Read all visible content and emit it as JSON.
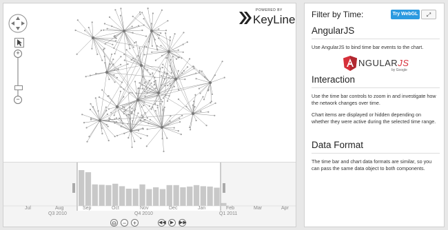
{
  "branding": {
    "powered_by": "POWERED BY",
    "product": "KeyLines"
  },
  "right_panel": {
    "filter_title": "Filter by Time:",
    "try_webgl_label": "Try WebGL",
    "expand_icon": "expand-icon",
    "sections": [
      {
        "heading": "AngularJS",
        "paragraphs": [
          "Use AngularJS to bind time bar events to the chart."
        ]
      },
      {
        "heading": "Interaction",
        "paragraphs": [
          "Use the time bar controls to zoom in and investigate how the network changes over time.",
          "Chart items are displayed or hidden depending on whether they were active during the selected time range."
        ]
      },
      {
        "heading": "Data Format",
        "paragraphs": [
          "The time bar and chart data formats are similar, so you can pass the same data object to both components."
        ]
      }
    ],
    "angular_logo": {
      "word_a": "A",
      "word_rest": "NGULAR",
      "word_js": "JS",
      "byline": "by Google",
      "colors": {
        "shield": "#d6303a",
        "text": "#333333",
        "js": "#d6303a"
      }
    }
  },
  "timebar": {
    "months": [
      "Jul",
      "Aug",
      "Sep",
      "Oct",
      "Nov",
      "Dec",
      "Jan",
      "Feb",
      "Mar",
      "Apr"
    ],
    "periods": [
      "Q3 2010",
      "Q4 2010",
      "Q1 2011"
    ],
    "bar_values": [
      100,
      94,
      60,
      59,
      58,
      62,
      55,
      48,
      48,
      60,
      47,
      52,
      47,
      58,
      58,
      52,
      54,
      58,
      55,
      54,
      51,
      8
    ],
    "selection_fraction": [
      0.25,
      0.74
    ],
    "colors": {
      "bar": "#c8c8c8",
      "selected_bg": "#ffffff",
      "handle": "#aaaaaa"
    }
  },
  "controls": {
    "navigation": [
      "pan-up-icon",
      "pan-left-icon",
      "pan-right-icon",
      "pan-down-icon"
    ],
    "pointer": "pointer-icon",
    "zoom_in": "+",
    "zoom_out": "−",
    "timebar_buttons": [
      "zoom-fit-icon",
      "zoom-out-icon",
      "zoom-in-icon",
      "previous-icon",
      "play-icon",
      "next-icon"
    ]
  }
}
